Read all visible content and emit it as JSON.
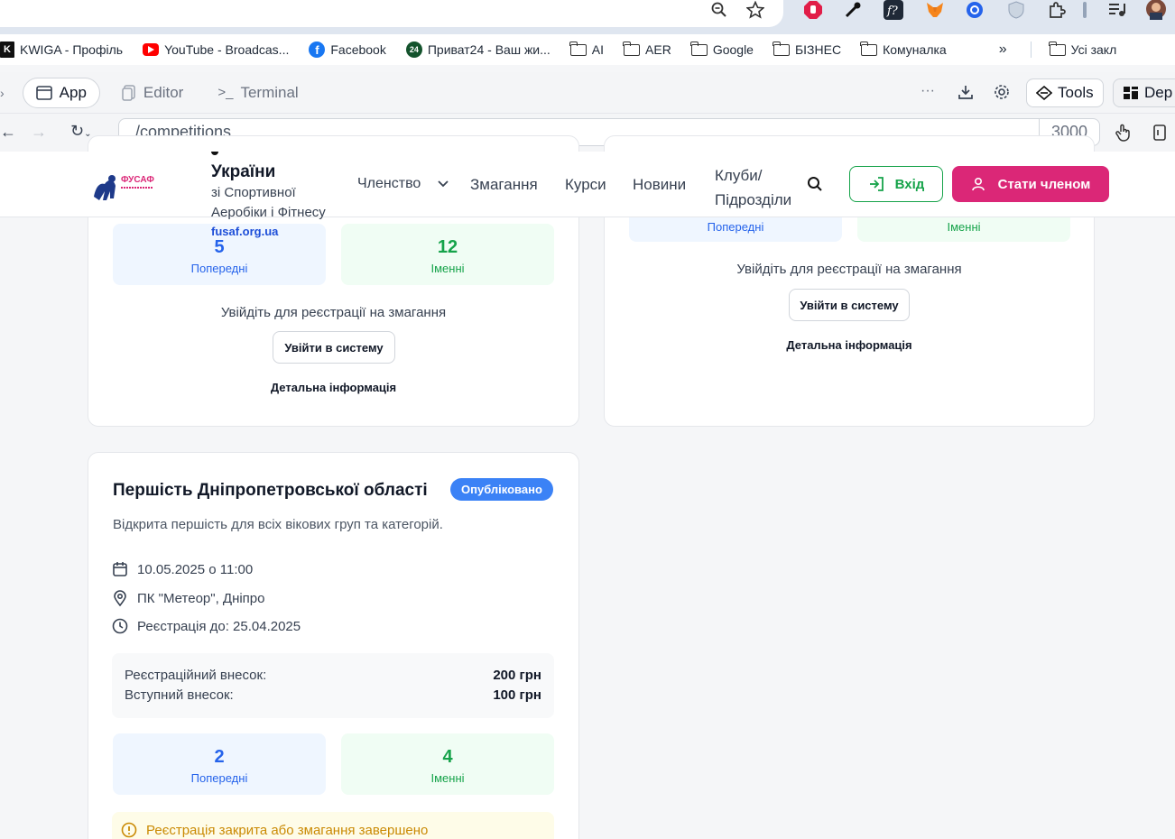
{
  "browser": {
    "bookmarks": [
      {
        "label": "KWIGA - Профіль",
        "icon": "kwiga-icon"
      },
      {
        "label": "YouTube - Broadcas...",
        "icon": "youtube-icon"
      },
      {
        "label": "Facebook",
        "icon": "facebook-icon"
      },
      {
        "label": "Приват24 - Ваш жи...",
        "icon": "privat24-icon"
      },
      {
        "label": "AI",
        "icon": "folder-icon"
      },
      {
        "label": "AER",
        "icon": "folder-icon"
      },
      {
        "label": "Google",
        "icon": "folder-icon"
      },
      {
        "label": "БІЗНЕС",
        "icon": "folder-icon"
      },
      {
        "label": "Комуналка",
        "icon": "folder-icon"
      }
    ],
    "all_bookmarks_label": "Усі закл",
    "privat_badge": "24"
  },
  "ide": {
    "tabs": [
      {
        "label": "App",
        "icon": "window-icon"
      },
      {
        "label": "Editor",
        "icon": "file-icon"
      },
      {
        "label": "Terminal",
        "icon": "terminal-icon"
      }
    ],
    "tools_label": "Tools",
    "deploy_label": "Dep",
    "url_path": "/competitions",
    "port": "3000"
  },
  "site": {
    "org_name_line1": "України",
    "org_subtitle_1": "зі Спортивної",
    "org_subtitle_2": "Аеробіки і Фітнесу",
    "org_site": "fusaf.org.ua",
    "logo_text": "ФУСАФ",
    "nav": {
      "membership": "Членство",
      "competitions": "Змагання",
      "courses": "Курси",
      "news": "Новини",
      "clubs_1": "Клуби/",
      "clubs_2": "Підрозділи"
    },
    "login_label": "Вхід",
    "member_label": "Стати членом"
  },
  "cards": {
    "card1": {
      "preliminary_count": "5",
      "preliminary_label": "Попередні",
      "named_count": "12",
      "named_label": "Іменні",
      "login_prompt": "Увійдіть для реєстрації на змагання",
      "login_button": "Увійти в систему",
      "details_link": "Детальна інформація"
    },
    "card2": {
      "preliminary_label": "Попередні",
      "named_label": "Іменні",
      "login_prompt": "Увійдіть для реєстрації на змагання",
      "login_button": "Увійти в систему",
      "details_link": "Детальна інформація"
    },
    "card3": {
      "title": "Першість Дніпропетровської області",
      "status": "Опубліковано",
      "description": "Відкрита першість для всіх вікових груп та категорій.",
      "date": "10.05.2025 о 11:00",
      "location": "ПК \"Метеор\", Дніпро",
      "registration_deadline": "Реєстрація до: 25.04.2025",
      "reg_fee_label": "Реєстраційний внесок:",
      "reg_fee_value": "200 грн",
      "entry_fee_label": "Вступний внесок:",
      "entry_fee_value": "100 грн",
      "preliminary_count": "2",
      "preliminary_label": "Попередні",
      "named_count": "4",
      "named_label": "Іменні",
      "closed_notice": "Реєстрація закрита або змагання завершено"
    }
  },
  "colors": {
    "primary_pink": "#db2777",
    "login_green": "#16a34a",
    "status_blue": "#3b82f6",
    "stat_blue": "#2563eb"
  }
}
